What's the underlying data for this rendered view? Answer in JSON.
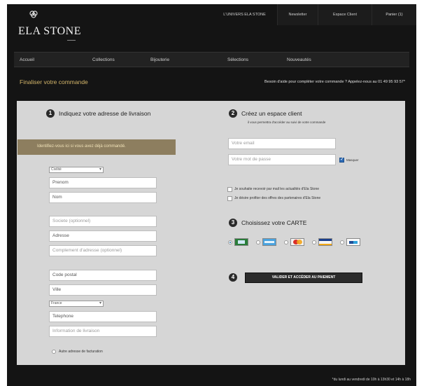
{
  "logo": {
    "text": "ELA STONE"
  },
  "topnav": [
    "L'UNIVERS ELA STONE",
    "Newsletter",
    "Espace Client",
    "Panier (1)"
  ],
  "mainnav": [
    "Accueil",
    "Collections",
    "Bijouterie",
    "Sélections",
    "Nouveautés"
  ],
  "page_title": "Finaliser votre commande",
  "help_text": "Besoin d'aide pour compléter votre commande ? Appelez-nous au 01 49 95 93 57*",
  "section1": {
    "number": "1",
    "title": "Indiquez votre adresse de livraison",
    "identify": "Identifiez-vous ici si vous avez déjà commandé.",
    "civility": "Civilité",
    "prenom": "Prenom",
    "nom": "Nom",
    "societe": "Societe (optionnel)",
    "adresse": "Adresse",
    "complement": "Complement d'adresse (optionnel)",
    "code_postal": "Code postal",
    "ville": "Ville",
    "pays": "France",
    "telephone": "Telephone",
    "info_livraison": "Information de livraison",
    "autre_adresse": "Autre adresse de facturation"
  },
  "section2": {
    "number": "2",
    "title": "Créez un espace client",
    "subtitle": "il vous permettra d'accéder au suivi de votre commande",
    "email": "Votre email",
    "password": "Votre mot de passe",
    "masquer": "Masquer",
    "newsletter_opt": "Je souhaite recevoir par mail les actualités d'Ela Stone",
    "partners_opt": "Je désire profiter des offres des partenaires d'Ela Stone"
  },
  "section3": {
    "number": "3",
    "title": "Choisissez votre CARTE",
    "cards": [
      "cb-card-icon",
      "amex-card-icon",
      "mastercard-card-icon",
      "visa-card-icon",
      "paypal-card-icon"
    ],
    "selected": 0
  },
  "section4": {
    "number": "4",
    "button": "VALIDER ET ACCÉDER AU PAIEMENT"
  },
  "footer_note": "*du lundi au vendredi de 10h à 13h30 et 14h à 18h",
  "colors": {
    "accent": "#d4b66a",
    "bar": "#8d7e5f",
    "panel": "#d6d6d6",
    "background": "#141414"
  }
}
